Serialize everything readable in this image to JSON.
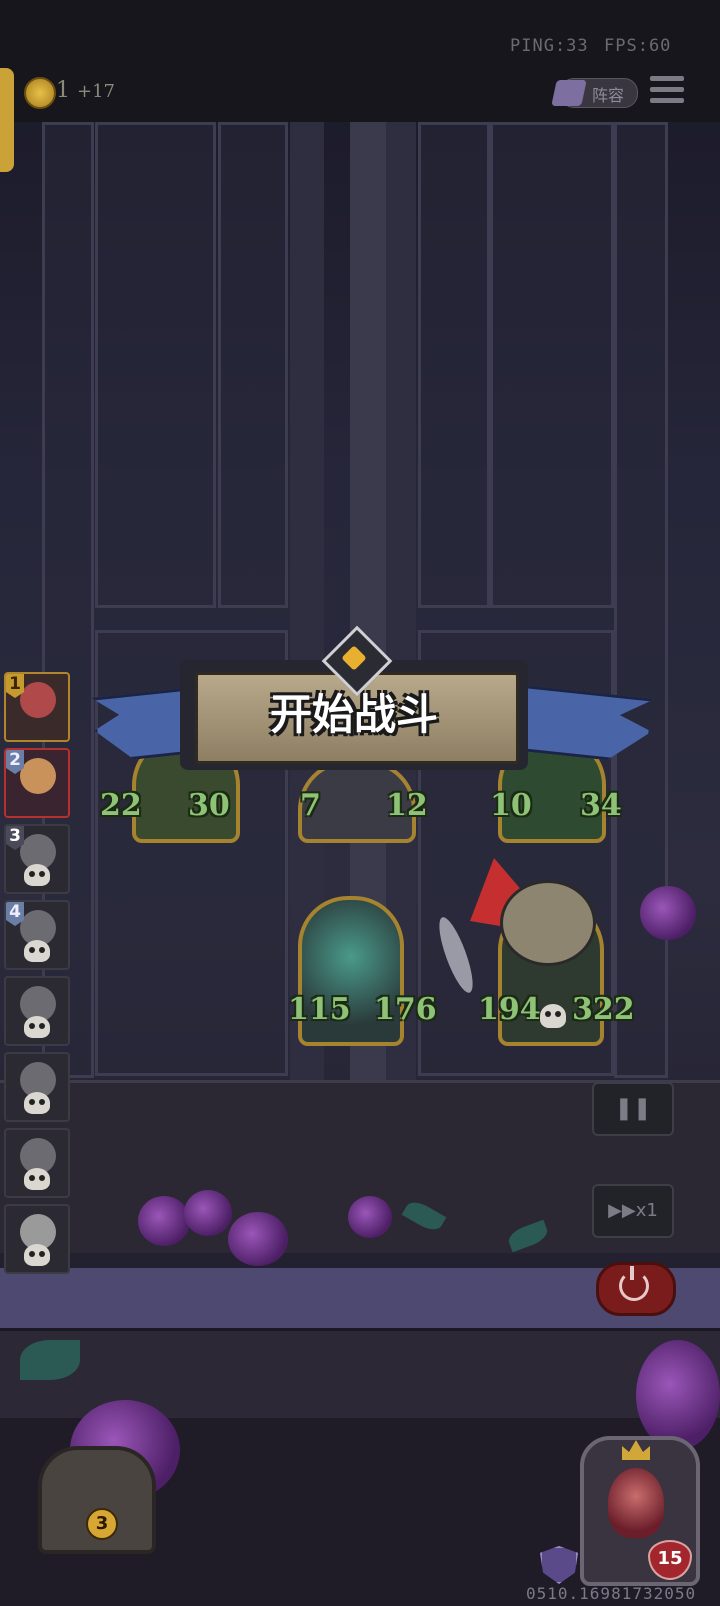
{
  "hud": {
    "ping": "PING:33",
    "fps": "FPS:60",
    "gold": "1",
    "gold_income": "+17",
    "lineup_label": "阵容"
  },
  "banner": {
    "title": "开始战斗"
  },
  "roster": [
    {
      "number": "1",
      "status": "active"
    },
    {
      "number": "2",
      "status": "active"
    },
    {
      "number": "3",
      "status": "defeated"
    },
    {
      "number": "4",
      "status": "defeated"
    },
    {
      "number": "",
      "status": "defeated"
    },
    {
      "number": "",
      "status": "defeated"
    },
    {
      "number": "",
      "status": "defeated"
    },
    {
      "number": "",
      "status": "defeated"
    }
  ],
  "units": {
    "top_left": {
      "attack": "22",
      "health": "30"
    },
    "top_middle": {
      "attack": "7",
      "health": "12"
    },
    "top_right": {
      "attack": "10",
      "health": "34"
    },
    "bottom_left": {
      "attack": "115",
      "health": "176"
    },
    "bottom_right": {
      "attack": "194",
      "health": "322"
    }
  },
  "controls": {
    "pause_label": "❚❚",
    "speed_label": "▶▶x1"
  },
  "bottom": {
    "chest_count": "3",
    "hero_health": "15",
    "version": "0510.16981732050"
  },
  "colors": {
    "ribbon": "#4a64a8",
    "stat_green": "#8ec276",
    "card_gold": "#a5832f"
  }
}
